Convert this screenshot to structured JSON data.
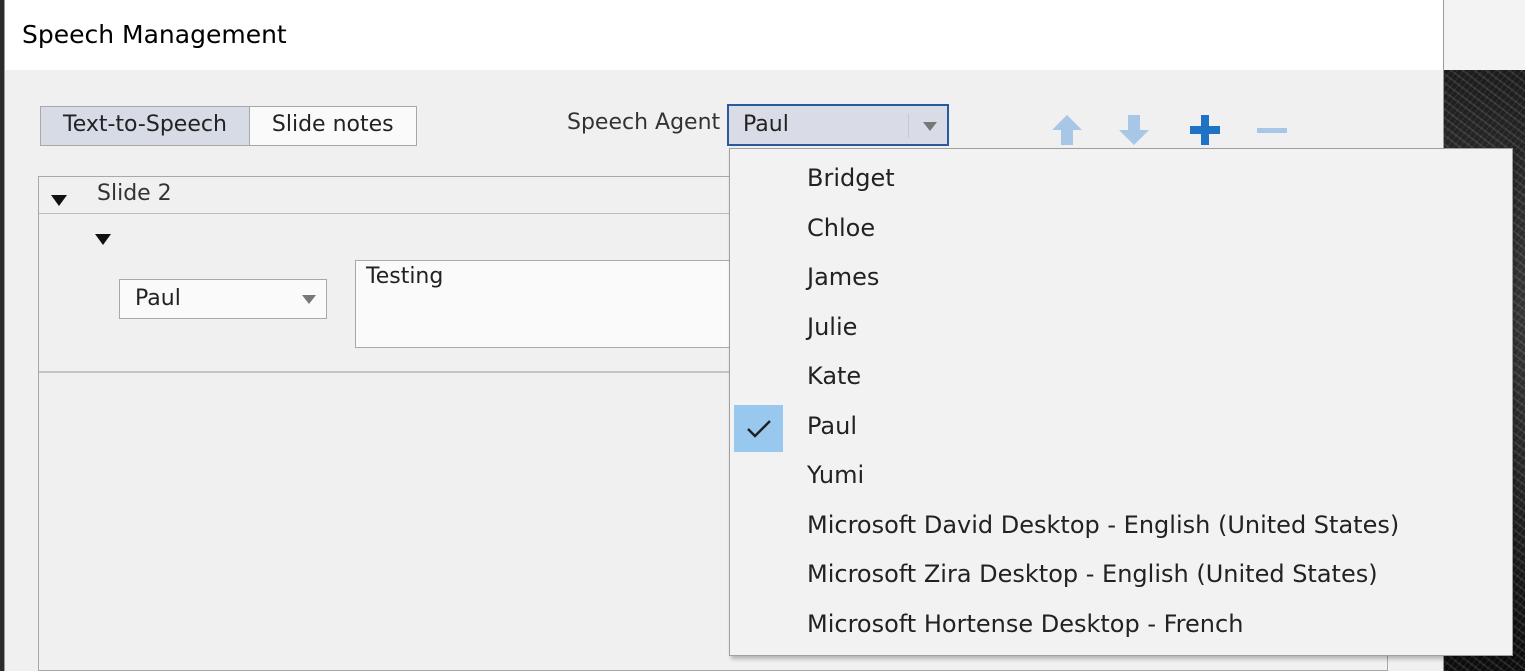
{
  "window": {
    "title": "Speech Management"
  },
  "tabs": [
    {
      "label": "Text-to-Speech",
      "active": true
    },
    {
      "label": "Slide notes",
      "active": false
    }
  ],
  "speech_agent": {
    "label": "Speech Agent",
    "selected": "Paul"
  },
  "toolbar": {
    "icons": [
      "move-up-icon",
      "move-down-icon",
      "add-icon",
      "remove-icon"
    ],
    "accent_color": "#1f73c7",
    "disabled_color": "#a8c6e6"
  },
  "slide": {
    "title": "Slide 2",
    "rows": [
      {
        "agent": "Paul",
        "text": "Testing"
      }
    ]
  },
  "agent_options": [
    {
      "label": "Bridget",
      "checked": false
    },
    {
      "label": "Chloe",
      "checked": false
    },
    {
      "label": "James",
      "checked": false
    },
    {
      "label": "Julie",
      "checked": false
    },
    {
      "label": "Kate",
      "checked": false
    },
    {
      "label": "Paul",
      "checked": true
    },
    {
      "label": "Yumi",
      "checked": false
    },
    {
      "label": "Microsoft David Desktop - English (United States)",
      "checked": false
    },
    {
      "label": "Microsoft Zira Desktop - English (United States)",
      "checked": false
    },
    {
      "label": "Microsoft Hortense Desktop - French",
      "checked": false
    }
  ]
}
